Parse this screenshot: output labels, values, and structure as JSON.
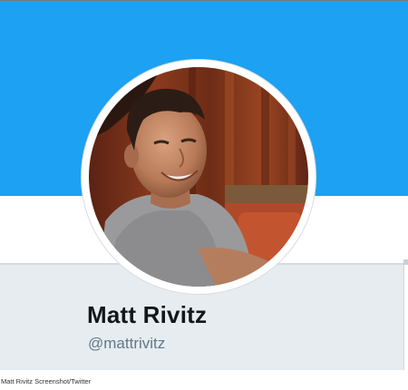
{
  "profile": {
    "display_name": "Matt Rivitz",
    "handle": "@mattrivitz"
  },
  "caption": "Matt Rivitz Screenshot/Twitter",
  "colors": {
    "banner": "#1da1f2",
    "panel": "#e6ecf0",
    "name": "#14171a",
    "handle": "#657786"
  }
}
